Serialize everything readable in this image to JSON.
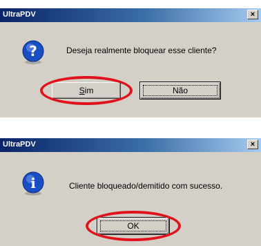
{
  "dialogs": [
    {
      "title": "UltraPDV",
      "close_label": "×",
      "icon": "question-icon",
      "message": "Deseja realmente bloquear esse cliente?",
      "buttons": [
        {
          "label": "Sim"
        },
        {
          "label": "Não"
        }
      ],
      "highlighted_button": "Sim"
    },
    {
      "title": "UltraPDV",
      "close_label": "×",
      "icon": "information-icon",
      "message": "Cliente bloqueado/demitido com sucesso.",
      "buttons": [
        {
          "label": "OK"
        }
      ],
      "highlighted_button": "OK"
    }
  ],
  "colors": {
    "titlebar_start": "#0a246a",
    "titlebar_end": "#a6caf0",
    "dialog_face": "#d4d0c8",
    "highlight_ring": "#e0131d",
    "icon_blue": "#1a4fc4"
  }
}
